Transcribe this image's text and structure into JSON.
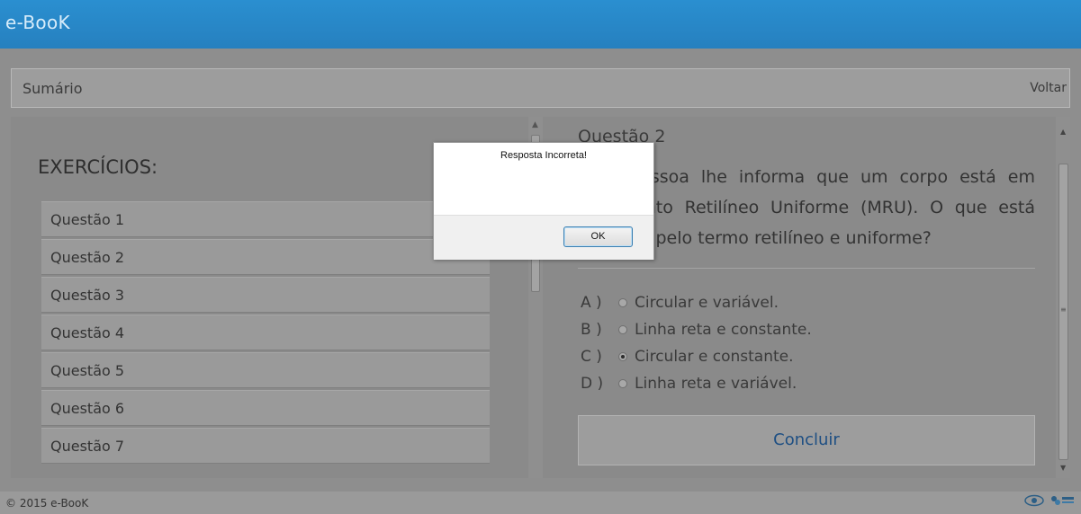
{
  "app": {
    "title": "e-BooK"
  },
  "nav": {
    "summary_label": "Sumário",
    "back_label": "Voltar"
  },
  "sidebar": {
    "title": "EXERCÍCIOS:",
    "questions": [
      "Questão 1",
      "Questão 2",
      "Questão 3",
      "Questão 4",
      "Questão 5",
      "Questão 6",
      "Questão 7"
    ]
  },
  "question": {
    "heading": "Questão 2",
    "text": "Uma pessoa lhe informa que um corpo está em Movimento Retilíneo Uniforme (MRU). O que está indicado pelo termo retilíneo e uniforme?",
    "options": [
      {
        "letter": "A )",
        "label": "Circular e variável.",
        "selected": false
      },
      {
        "letter": "B )",
        "label": "Linha reta e constante.",
        "selected": false
      },
      {
        "letter": "C )",
        "label": "Circular e constante.",
        "selected": true
      },
      {
        "letter": "D )",
        "label": "Linha reta e variável.",
        "selected": false
      }
    ],
    "finish_label": "Concluir"
  },
  "dialog": {
    "message": "Resposta Incorreta!",
    "ok_label": "OK"
  },
  "footer": {
    "copyright": "© 2015 e-BooK"
  },
  "colors": {
    "header": "#2a8fd0",
    "accent_link": "#1e4f83",
    "overlay": "#8e8e8e"
  },
  "icons": {
    "logo_left": "eye-logo-icon",
    "logo_right": "ufg-logo-icon"
  }
}
